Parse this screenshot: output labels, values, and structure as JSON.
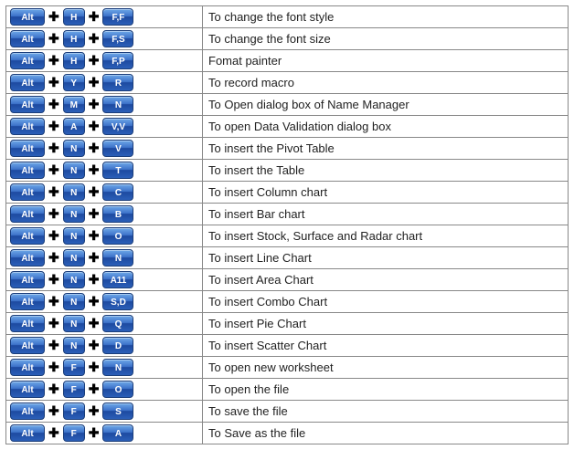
{
  "plus_glyph": "✚",
  "shortcuts": [
    {
      "k1": "Alt",
      "k2": "H",
      "k3": "F,F",
      "desc": "To change the font style"
    },
    {
      "k1": "Alt",
      "k2": "H",
      "k3": "F,S",
      "desc": "To change the font size"
    },
    {
      "k1": "Alt",
      "k2": "H",
      "k3": "F,P",
      "desc": "Fomat painter"
    },
    {
      "k1": "Alt",
      "k2": "Y",
      "k3": "R",
      "desc": "To record macro"
    },
    {
      "k1": "Alt",
      "k2": "M",
      "k3": "N",
      "desc": "To Open dialog box of Name Manager"
    },
    {
      "k1": "Alt",
      "k2": "A",
      "k3": "V,V",
      "desc": "To open Data Validation dialog box"
    },
    {
      "k1": "Alt",
      "k2": "N",
      "k3": "V",
      "desc": "To insert the Pivot Table"
    },
    {
      "k1": "Alt",
      "k2": "N",
      "k3": "T",
      "desc": "To insert the Table"
    },
    {
      "k1": "Alt",
      "k2": "N",
      "k3": "C",
      "desc": "To insert Column chart"
    },
    {
      "k1": "Alt",
      "k2": "N",
      "k3": "B",
      "desc": "To insert Bar chart"
    },
    {
      "k1": "Alt",
      "k2": "N",
      "k3": "O",
      "desc": "To insert Stock, Surface and Radar chart"
    },
    {
      "k1": "Alt",
      "k2": "N",
      "k3": "N",
      "desc": "To insert Line Chart"
    },
    {
      "k1": "Alt",
      "k2": "N",
      "k3": "A11",
      "desc": "To insert Area Chart"
    },
    {
      "k1": "Alt",
      "k2": "N",
      "k3": "S,D",
      "desc": "To insert Combo Chart"
    },
    {
      "k1": "Alt",
      "k2": "N",
      "k3": "Q",
      "desc": "To insert Pie Chart"
    },
    {
      "k1": "Alt",
      "k2": "N",
      "k3": "D",
      "desc": "To insert Scatter Chart"
    },
    {
      "k1": "Alt",
      "k2": "F",
      "k3": "N",
      "desc": "To open new worksheet"
    },
    {
      "k1": "Alt",
      "k2": "F",
      "k3": "O",
      "desc": "To open the file"
    },
    {
      "k1": "Alt",
      "k2": "F",
      "k3": "S",
      "desc": "To save the file"
    },
    {
      "k1": "Alt",
      "k2": "F",
      "k3": "A",
      "desc": "To Save as the file"
    }
  ]
}
